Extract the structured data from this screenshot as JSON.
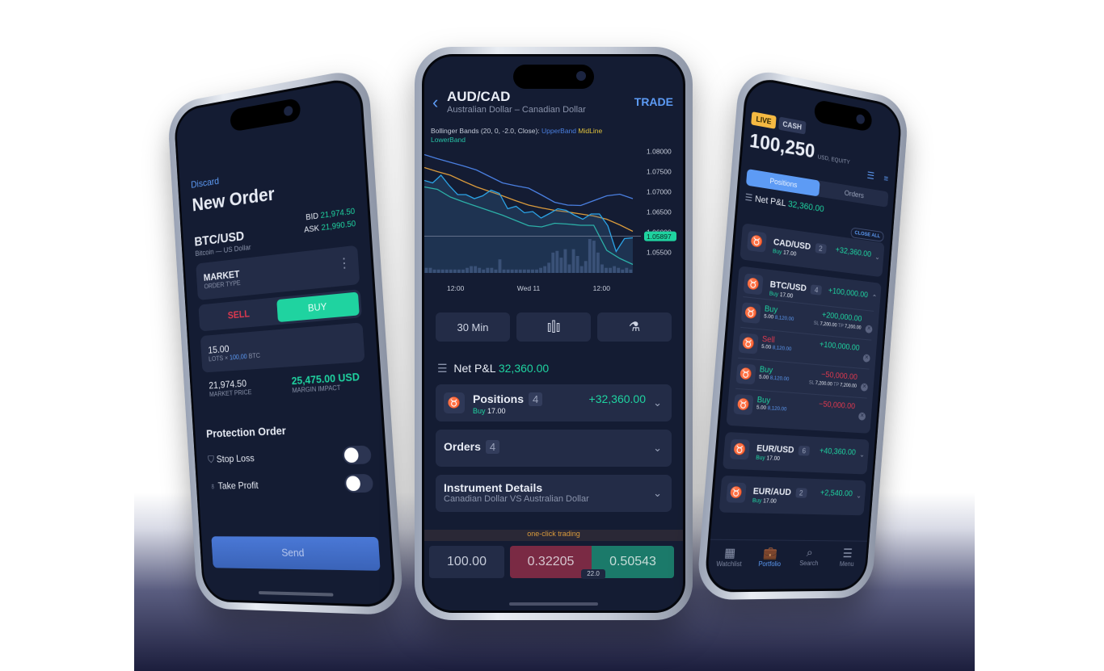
{
  "left": {
    "discard": "Discard",
    "title": "New Order",
    "symbol": "BTC/USD",
    "symbol_name": "Bitcoin — US Dollar",
    "bid_label": "BID",
    "bid": "21,974.50",
    "ask_label": "ASK",
    "ask": "21,990.50",
    "order_type": "MARKET",
    "order_type_label": "ORDER TYPE",
    "sell": "SELL",
    "buy": "BUY",
    "lots": "15.00",
    "lots_label": "LOTS ×",
    "lots_size": "100,00",
    "lots_unit": "BTC",
    "market_price": "21,974.50",
    "market_price_label": "MARKET PRICE",
    "margin": "25,475.00 USD",
    "margin_label": "MARGIN IMPACT",
    "protection_title": "Protection Order",
    "stop_loss": "Stop Loss",
    "take_profit": "Take Profit",
    "stop_loss_on": false,
    "take_profit_on": false,
    "send": "Send"
  },
  "center": {
    "symbol": "AUD/CAD",
    "symbol_name": "Australian Dollar – Canadian Dollar",
    "trade": "TRADE",
    "indicator": {
      "text": "Bollinger Bands (20, 0, -2.0, Close):",
      "upper": "UpperBand",
      "mid": "MidLine",
      "lower": "LowerBand"
    },
    "timeframe": "30 Min",
    "net_pnl_label": "Net P&L",
    "net_pnl": "32,360.00",
    "positions": {
      "label": "Positions",
      "count": "4",
      "side": "Buy",
      "qty": "17.00",
      "pnl": "+32,360.00"
    },
    "orders": {
      "label": "Orders",
      "count": "4"
    },
    "details": {
      "label": "Instrument Details",
      "sub": "Canadian Dollar VS Australian Dollar"
    },
    "one_click": "one-click trading",
    "amount": "100.00",
    "sell_price": "0.32205",
    "buy_price": "0.50543",
    "spread": "22.0"
  },
  "chart_data": {
    "type": "line",
    "y_ticks": [
      "1.08000",
      "1.07500",
      "1.07000",
      "1.06500",
      "1.06000",
      "1.05500"
    ],
    "ylim": [
      1.0515,
      1.0815
    ],
    "x_ticks": [
      "12:00",
      "Wed 11",
      "12:00"
    ],
    "current_price": "1.05897",
    "current_value": 1.05897,
    "series": [
      {
        "name": "UpperBand",
        "color": "#4a7fe0",
        "values": [
          1.0792,
          1.0782,
          1.0773,
          1.0764,
          1.0754,
          1.0738,
          1.0722,
          1.0715,
          1.0709,
          1.0692,
          1.0674,
          1.0667,
          1.0666,
          1.0678,
          1.069,
          1.0694,
          1.0683
        ]
      },
      {
        "name": "MidLine",
        "color": "#d99a3c",
        "values": [
          1.076,
          1.075,
          1.0741,
          1.0726,
          1.0712,
          1.0701,
          1.069,
          1.0678,
          1.0667,
          1.066,
          1.0654,
          1.065,
          1.0645,
          1.064,
          1.0632,
          1.0618,
          1.0602
        ]
      },
      {
        "name": "LowerBand",
        "color": "#27c2a6",
        "values": [
          1.0712,
          1.0706,
          1.0687,
          1.0675,
          1.0664,
          1.0653,
          1.0642,
          1.0629,
          1.0616,
          1.0613,
          1.0622,
          1.062,
          1.0617,
          1.0617,
          1.0555,
          1.0535,
          1.052
        ]
      },
      {
        "name": "Price",
        "color": "#2ba3e6",
        "values": [
          1.0728,
          1.0722,
          1.0741,
          1.0715,
          1.0693,
          1.0693,
          1.0683,
          1.069,
          1.0704,
          1.0696,
          1.0658,
          1.0664,
          1.0648,
          1.0651,
          1.0635,
          1.0646,
          1.0658,
          1.0654,
          1.0642,
          1.0632,
          1.0645,
          1.0645,
          1.0616,
          1.0552,
          1.0584,
          1.0586
        ]
      }
    ],
    "volume": [
      3,
      3,
      2,
      2,
      2,
      2,
      2,
      2,
      2,
      2,
      3,
      4,
      4,
      3,
      2,
      3,
      3,
      2,
      8,
      2,
      2,
      2,
      2,
      2,
      2,
      2,
      2,
      2,
      3,
      4,
      6,
      12,
      13,
      9,
      14,
      5,
      14,
      10,
      4,
      7,
      20,
      19,
      12,
      5,
      3,
      3,
      4,
      3,
      2,
      3,
      2
    ]
  },
  "right": {
    "live": "LIVE",
    "cash": "CASH",
    "equity": "100,250",
    "equity_unit": "USD, EQUITY",
    "tab_positions": "Positions",
    "tab_orders": "Orders",
    "net_pnl_label": "Net P&L",
    "net_pnl": "32,360.00",
    "close_all": "CLOSE ALL",
    "positions": [
      {
        "symbol": "CAD/USD",
        "count": "2",
        "side": "Buy",
        "qty": "17.00",
        "pnl": "+32,360.00",
        "expanded": false
      },
      {
        "symbol": "BTC/USD",
        "count": "4",
        "side": "Buy",
        "qty": "17.00",
        "pnl": "+100,000.00",
        "expanded": true,
        "trades": [
          {
            "side": "Buy",
            "qty": "5.00",
            "price": "8,120.00",
            "pnl": "+200,000.00",
            "sl": "7,200.00",
            "tp": "7,200.00"
          },
          {
            "side": "Sell",
            "qty": "5.00",
            "price": "8,120.00",
            "pnl": "+100,000.00"
          },
          {
            "side": "Buy",
            "qty": "5.00",
            "price": "8,120.00",
            "pnl": "−50,000.00",
            "sl": "7,200.00",
            "tp": "7,200.00"
          },
          {
            "side": "Buy",
            "qty": "5.00",
            "price": "8,120.00",
            "pnl": "−50,000.00"
          }
        ]
      },
      {
        "symbol": "EUR/USD",
        "count": "6",
        "side": "Buy",
        "qty": "17.00",
        "pnl": "+40,360.00",
        "expanded": false
      },
      {
        "symbol": "EUR/AUD",
        "count": "2",
        "side": "Buy",
        "qty": "17.00",
        "pnl": "+2,540.00",
        "expanded": false
      }
    ],
    "nav": [
      {
        "label": "Watchlist",
        "icon": "grid-icon"
      },
      {
        "label": "Portfolio",
        "icon": "briefcase-icon",
        "active": true
      },
      {
        "label": "Search",
        "icon": "search-icon"
      },
      {
        "label": "Menu",
        "icon": "menu-icon"
      }
    ]
  },
  "colors": {
    "green": "#1fd3a0",
    "red": "#e0394f",
    "blue": "#5d9bf5",
    "live": "#f5b942",
    "bg": "#141c33"
  }
}
